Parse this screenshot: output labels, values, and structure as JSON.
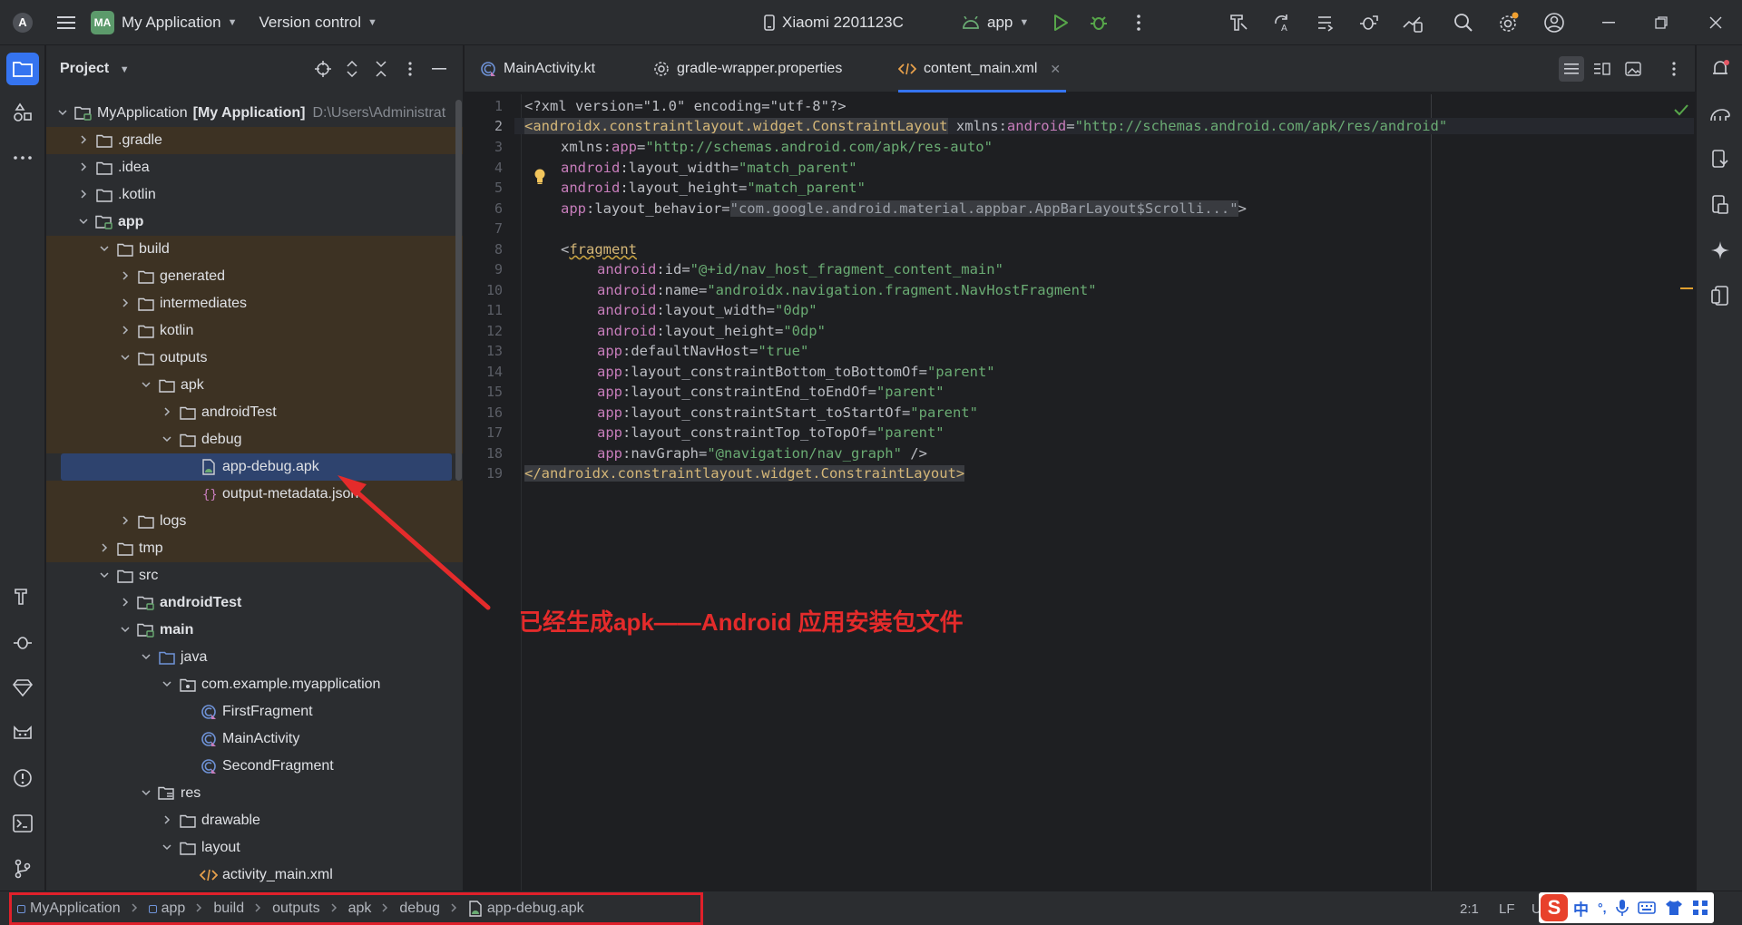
{
  "titlebar": {
    "logo_glyph": "A",
    "project_badge": "MA",
    "project_name": "My Application",
    "vcs_label": "Version control",
    "device": "Xiaomi 2201123C",
    "run_config": "app"
  },
  "project_panel": {
    "title": "Project",
    "tree": [
      {
        "label": "MyApplication",
        "extra": "[My Application]",
        "hint": "D:\\Users\\Administrat",
        "depth": 0,
        "chev": "open",
        "icon": "module-folder-icon",
        "bold": false,
        "excluded": false
      },
      {
        "label": ".gradle",
        "depth": 1,
        "chev": "closed",
        "icon": "folder-icon",
        "excluded": true
      },
      {
        "label": ".idea",
        "depth": 1,
        "chev": "closed",
        "icon": "folder-icon",
        "excluded": false
      },
      {
        "label": ".kotlin",
        "depth": 1,
        "chev": "closed",
        "icon": "folder-icon",
        "excluded": false
      },
      {
        "label": "app",
        "depth": 1,
        "chev": "open",
        "icon": "module-folder-icon",
        "bold": true,
        "excluded": false
      },
      {
        "label": "build",
        "depth": 2,
        "chev": "open",
        "icon": "folder-icon",
        "excluded": true
      },
      {
        "label": "generated",
        "depth": 3,
        "chev": "closed",
        "icon": "folder-icon",
        "excluded": true
      },
      {
        "label": "intermediates",
        "depth": 3,
        "chev": "closed",
        "icon": "folder-icon",
        "excluded": true
      },
      {
        "label": "kotlin",
        "depth": 3,
        "chev": "closed",
        "icon": "folder-icon",
        "excluded": true
      },
      {
        "label": "outputs",
        "depth": 3,
        "chev": "open",
        "icon": "folder-icon",
        "excluded": true
      },
      {
        "label": "apk",
        "depth": 4,
        "chev": "open",
        "icon": "folder-icon",
        "excluded": true
      },
      {
        "label": "androidTest",
        "depth": 5,
        "chev": "closed",
        "icon": "folder-icon",
        "excluded": true
      },
      {
        "label": "debug",
        "depth": 5,
        "chev": "open",
        "icon": "folder-icon",
        "excluded": true
      },
      {
        "label": "app-debug.apk",
        "depth": 6,
        "chev": "none",
        "icon": "apk-file-icon",
        "excluded": true,
        "selected": true
      },
      {
        "label": "output-metadata.json",
        "depth": 6,
        "chev": "none",
        "icon": "json-file-icon",
        "excluded": true
      },
      {
        "label": "logs",
        "depth": 3,
        "chev": "closed",
        "icon": "folder-icon",
        "excluded": true
      },
      {
        "label": "tmp",
        "depth": 2,
        "chev": "closed",
        "icon": "folder-icon",
        "excluded": true
      },
      {
        "label": "src",
        "depth": 2,
        "chev": "open",
        "icon": "folder-icon",
        "excluded": false
      },
      {
        "label": "androidTest",
        "depth": 3,
        "chev": "closed",
        "icon": "module-folder-icon",
        "bold": true,
        "excluded": false
      },
      {
        "label": "main",
        "depth": 3,
        "chev": "open",
        "icon": "module-folder-icon",
        "bold": true,
        "excluded": false
      },
      {
        "label": "java",
        "depth": 4,
        "chev": "open",
        "icon": "source-folder-icon",
        "excluded": false
      },
      {
        "label": "com.example.myapplication",
        "depth": 5,
        "chev": "open",
        "icon": "package-icon",
        "excluded": false
      },
      {
        "label": "FirstFragment",
        "depth": 6,
        "chev": "none",
        "icon": "kotlin-class-icon",
        "excluded": false
      },
      {
        "label": "MainActivity",
        "depth": 6,
        "chev": "none",
        "icon": "kotlin-class-icon",
        "excluded": false
      },
      {
        "label": "SecondFragment",
        "depth": 6,
        "chev": "none",
        "icon": "kotlin-class-icon",
        "excluded": false
      },
      {
        "label": "res",
        "depth": 4,
        "chev": "open",
        "icon": "resource-folder-icon",
        "excluded": false
      },
      {
        "label": "drawable",
        "depth": 5,
        "chev": "closed",
        "icon": "folder-icon",
        "excluded": false
      },
      {
        "label": "layout",
        "depth": 5,
        "chev": "open",
        "icon": "folder-icon",
        "excluded": false
      },
      {
        "label": "activity_main.xml",
        "depth": 6,
        "chev": "none",
        "icon": "xml-file-icon",
        "excluded": false
      }
    ]
  },
  "editor": {
    "tabs": [
      {
        "label": "MainActivity.kt",
        "icon": "kotlin-class-icon",
        "active": false
      },
      {
        "label": "gradle-wrapper.properties",
        "icon": "gear-icon",
        "active": false
      },
      {
        "label": "content_main.xml",
        "icon": "xml-file-icon",
        "active": true
      }
    ],
    "lines": [
      "1",
      "2",
      "3",
      "4",
      "5",
      "6",
      "7",
      "8",
      "9",
      "10",
      "11",
      "12",
      "13",
      "14",
      "15",
      "16",
      "17",
      "18",
      "19"
    ],
    "code": {
      "l1_a": "<?xml version=\"1.0\" encoding=\"utf-8\"?>",
      "l2_tag": "<androidx.constraintlayout.widget.ConstraintLayout",
      "l2_attr": " xmlns:",
      "l2_ns": "android",
      "l2_eq": "=",
      "l2_val": "\"http://schemas.android.com/apk/res/android\"",
      "l3_attr": "xmlns:",
      "l3_ns": "app",
      "l3_val": "\"http://schemas.android.com/apk/res-auto\"",
      "l4_ns": "android",
      "l4_attr": ":layout_width=",
      "l4_val": "\"match_parent\"",
      "l5_ns": "android",
      "l5_attr": ":layout_height=",
      "l5_val": "\"match_parent\"",
      "l6_ns": "app",
      "l6_attr": ":layout_behavior=",
      "l6_val": "\"com.google.android.material.appbar.AppBarLayout$Scrolli...\"",
      "l6_end": ">",
      "l8_lt": "<",
      "l8_tag": "fragment",
      "l9_ns": "android",
      "l9_attr": ":id=",
      "l9_val": "\"@+id/nav_host_fragment_content_main\"",
      "l10_ns": "android",
      "l10_attr": ":name=",
      "l10_val": "\"androidx.navigation.fragment.NavHostFragment\"",
      "l11_ns": "android",
      "l11_attr": ":layout_width=",
      "l11_val": "\"0dp\"",
      "l12_ns": "android",
      "l12_attr": ":layout_height=",
      "l12_val": "\"0dp\"",
      "l13_ns": "app",
      "l13_attr": ":defaultNavHost=",
      "l13_val": "\"true\"",
      "l14_ns": "app",
      "l14_attr": ":layout_constraintBottom_toBottomOf=",
      "l14_val": "\"parent\"",
      "l15_ns": "app",
      "l15_attr": ":layout_constraintEnd_toEndOf=",
      "l15_val": "\"parent\"",
      "l16_ns": "app",
      "l16_attr": ":layout_constraintStart_toStartOf=",
      "l16_val": "\"parent\"",
      "l17_ns": "app",
      "l17_attr": ":layout_constraintTop_toTopOf=",
      "l17_val": "\"parent\"",
      "l18_ns": "app",
      "l18_attr": ":navGraph=",
      "l18_val": "\"@navigation/nav_graph\"",
      "l18_end": " />",
      "l19_tag": "</androidx.constraintlayout.widget.ConstraintLayout>"
    }
  },
  "annotation": {
    "text": "已经生成apk——Android 应用安装包文件",
    "color": "#e42b2b"
  },
  "statusbar": {
    "crumbs": [
      "MyApplication",
      "app",
      "build",
      "outputs",
      "apk",
      "debug",
      "app-debug.apk"
    ],
    "position": "2:1",
    "line_ending": "LF",
    "encoding": "U",
    "ime_logo": "S",
    "ime_lang": "中",
    "ime_punct": "°,"
  },
  "colors": {
    "accent": "#3574f0",
    "panel_bg": "#2b2d30",
    "editor_bg": "#1e1f22",
    "excluded_bg": "#3d3223",
    "selection_bg": "#2e436e",
    "annotation_red": "#e42b2b"
  }
}
